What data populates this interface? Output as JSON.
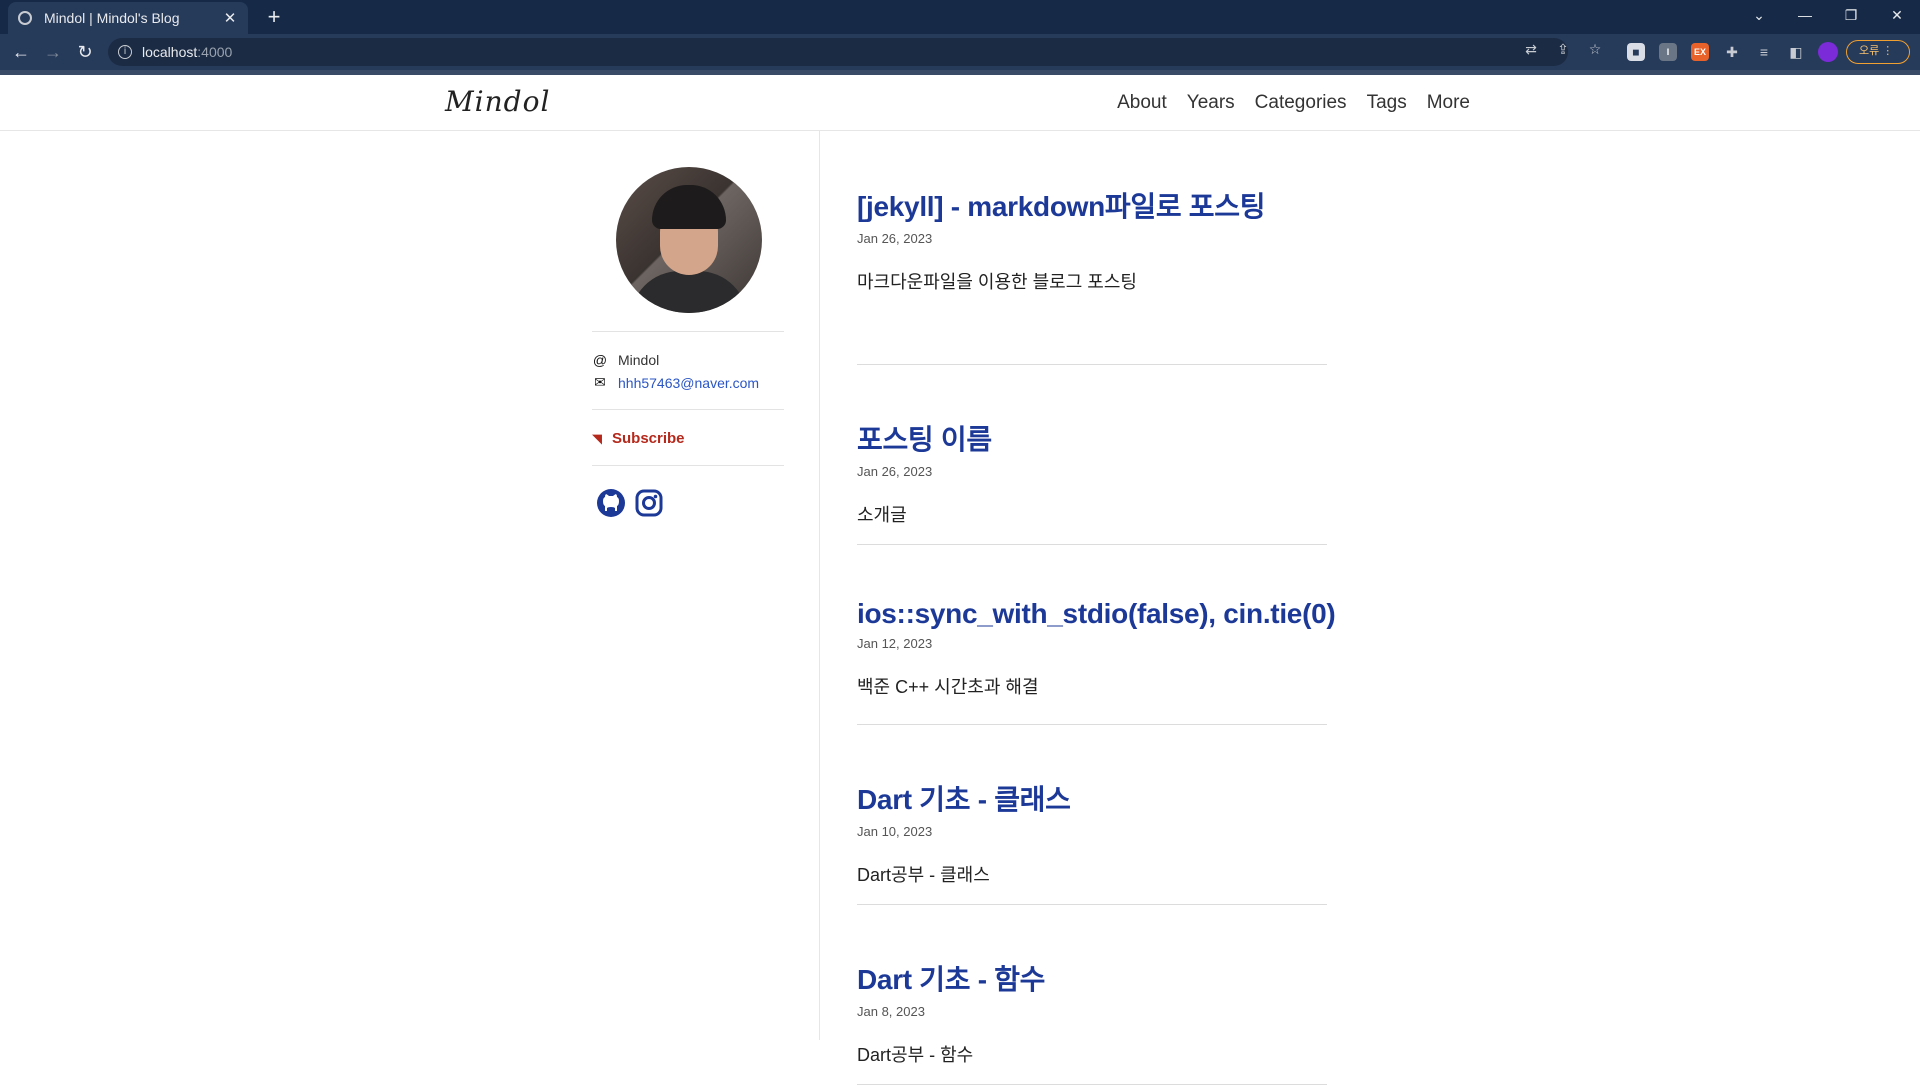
{
  "browser": {
    "tab_title": "Mindol | Mindol's Blog",
    "url_host": "localhost",
    "url_port": ":4000",
    "error_label": "오류"
  },
  "site": {
    "logo": "Mindol",
    "nav": [
      "About",
      "Years",
      "Categories",
      "Tags",
      "More"
    ]
  },
  "sidebar": {
    "name": "Mindol",
    "email": "hhh57463@naver.com",
    "subscribe_label": "Subscribe"
  },
  "posts": [
    {
      "title": "[jekyll] - markdown파일로 포스팅",
      "date": "Jan 26, 2023",
      "excerpt": "마크다운파일을 이용한 블로그 포스팅"
    },
    {
      "title": "포스팅 이름",
      "date": "Jan 26, 2023",
      "excerpt": "소개글"
    },
    {
      "title": "ios::sync_with_stdio(false), cin.tie(0)",
      "date": "Jan 12, 2023",
      "excerpt": "백준 C++ 시간초과 해결"
    },
    {
      "title": "Dart 기초 - 클래스",
      "date": "Jan 10, 2023",
      "excerpt": "Dart공부 - 클래스"
    },
    {
      "title": "Dart 기초 - 함수",
      "date": "Jan 8, 2023",
      "excerpt": "Dart공부 - 함수"
    }
  ],
  "colors": {
    "link": "#1d3998",
    "subscribe": "#b5291c",
    "email_link": "#2a55c4"
  }
}
